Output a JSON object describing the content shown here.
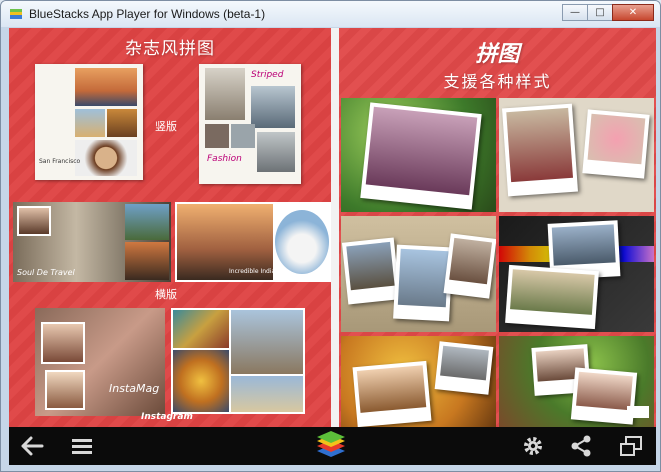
{
  "window": {
    "title": "BlueStacks App Player for Windows (beta-1)"
  },
  "left": {
    "title": "杂志风拼图",
    "label_vertical": "竖版",
    "label_horizontal": "横版",
    "card1_caption": "San Francisco",
    "card2_caption_top": "Striped",
    "card2_caption_bottom": "Fashion",
    "strip_caption": "Soul De Travel",
    "india_caption": "Incredible India",
    "instamag_title": "InstaMag",
    "instagram_label": "Instagram"
  },
  "right": {
    "title_line1": "拼图",
    "title_line2": "支援各种样式"
  },
  "icons": {
    "back": "back-arrow-icon",
    "menu": "menu-icon",
    "logo": "bluestacks-logo-icon",
    "settings": "gear-icon",
    "share": "share-icon",
    "window": "window-toggle-icon"
  },
  "colors": {
    "panel_red": "#e04a4a",
    "nav_black": "#0b0b0b"
  }
}
